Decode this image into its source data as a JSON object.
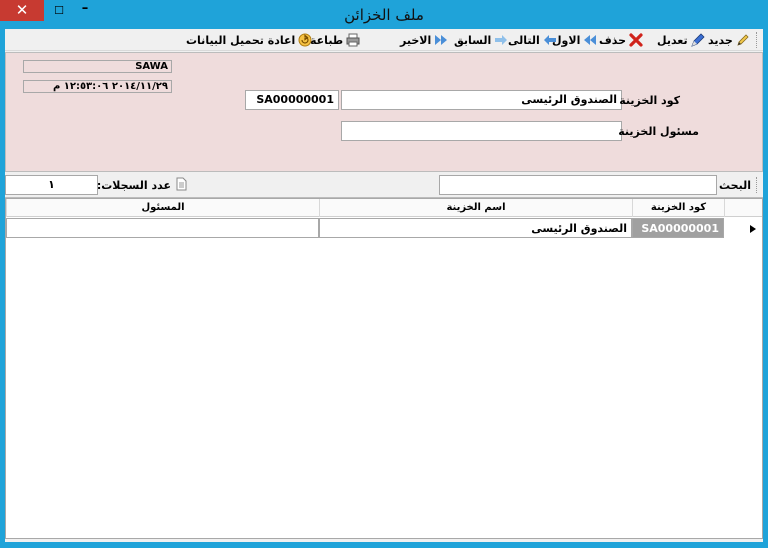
{
  "window": {
    "title": "ملف الخزائن",
    "close_glyph": "✕",
    "maximize_glyph": "☐",
    "minimize_glyph": "–"
  },
  "toolbar": {
    "new_label": "جديد",
    "edit_label": "تعديل",
    "delete_label": "حذف",
    "first_label": "الاول",
    "next_label": "التالى",
    "previous_label": "السابق",
    "last_label": "الاخير",
    "print_label": "طباعة",
    "reload_label": "اعادة تحميل البيانات"
  },
  "header": {
    "company": "SAWA",
    "datetime": "٢٠١٤/١١/٢٩ ١٢:٥٣:٠٦ م",
    "code_label": "كود الخزينة",
    "code_value": "SA00000001",
    "name_value": "الصندوق الرئيسى",
    "manager_label": "مسئول الخزينة",
    "manager_value": ""
  },
  "search": {
    "label": "البحث",
    "value": "",
    "count_label": "عدد السجلات:",
    "count_value": "١"
  },
  "grid": {
    "columns": [
      "كود الخزينة",
      "اسم الخزينة",
      "المسئول"
    ],
    "rows": [
      {
        "code": "SA00000001",
        "name": "الصندوق الرئيسى",
        "manager": ""
      }
    ]
  },
  "colors": {
    "title_bar": "#1fa3d9",
    "close_button": "#c73a31",
    "header_panel": "#efdcdc",
    "selected_cell": "#a0a0a0"
  }
}
